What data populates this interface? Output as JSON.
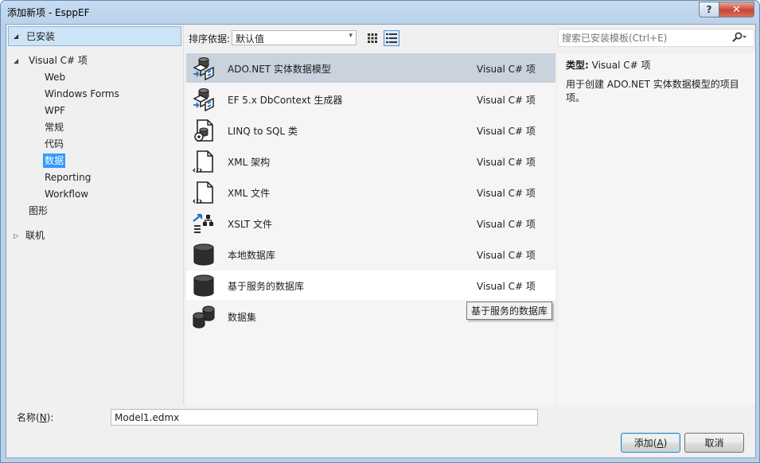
{
  "window": {
    "title": "添加新项 - EsppEF",
    "help_label": "?",
    "close_label": "✕"
  },
  "sidebar": {
    "installed": "已安装",
    "tree": [
      {
        "label": "Visual C# 项",
        "indent": 0,
        "expanded": true
      },
      {
        "label": "Web",
        "indent": 1
      },
      {
        "label": "Windows Forms",
        "indent": 1
      },
      {
        "label": "WPF",
        "indent": 1
      },
      {
        "label": "常规",
        "indent": 1
      },
      {
        "label": "代码",
        "indent": 1
      },
      {
        "label": "数据",
        "indent": 1,
        "selected": true
      },
      {
        "label": "Reporting",
        "indent": 1
      },
      {
        "label": "Workflow",
        "indent": 1
      },
      {
        "label": "图形",
        "indent": 0
      },
      {
        "label": "联机",
        "indent": 0,
        "collapsed": true
      }
    ]
  },
  "toolbar": {
    "sort_label": "排序依据:",
    "sort_value": "默认值"
  },
  "templates": [
    {
      "name": "ADO.NET 实体数据模型",
      "type": "Visual C# 项",
      "icon": "entity-model-icon",
      "selected": true
    },
    {
      "name": "EF 5.x DbContext 生成器",
      "type": "Visual C# 项",
      "icon": "dbcontext-generator-icon"
    },
    {
      "name": "LINQ to SQL 类",
      "type": "Visual C# 项",
      "icon": "linq-to-sql-icon"
    },
    {
      "name": "XML 架构",
      "type": "Visual C# 项",
      "icon": "xml-schema-icon"
    },
    {
      "name": "XML 文件",
      "type": "Visual C# 项",
      "icon": "xml-file-icon"
    },
    {
      "name": "XSLT 文件",
      "type": "Visual C# 项",
      "icon": "xslt-file-icon"
    },
    {
      "name": "本地数据库",
      "type": "Visual C# 项",
      "icon": "local-database-icon"
    },
    {
      "name": "基于服务的数据库",
      "type": "Visual C# 项",
      "icon": "service-database-icon",
      "hover": true
    },
    {
      "name": "数据集",
      "type": "",
      "icon": "dataset-icon"
    }
  ],
  "tooltip": "基于服务的数据库",
  "search": {
    "placeholder": "搜索已安装模板(Ctrl+E)"
  },
  "details": {
    "type_label": "类型:",
    "type_value": "Visual C# 项",
    "description": "用于创建 ADO.NET 实体数据模型的项目项。"
  },
  "footer": {
    "name_label": "名称(",
    "name_key": "N",
    "name_label_end": "):",
    "name_value": "Model1.edmx",
    "add_label": "添加(",
    "add_key": "A",
    "add_label_end": ")",
    "cancel_label": "取消"
  },
  "colors": {
    "selection_blue": "#3399ff",
    "selected_row": "#c9d2dd",
    "installed_bg": "#cde4f7"
  }
}
